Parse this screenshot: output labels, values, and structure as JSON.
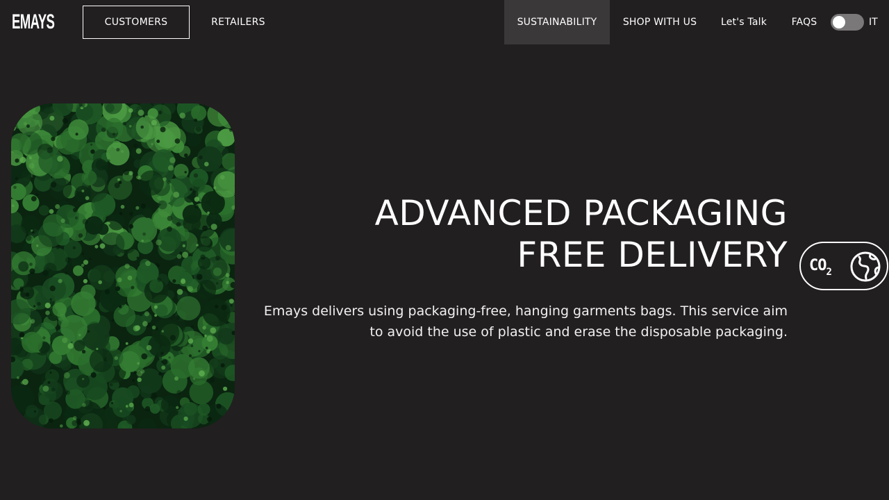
{
  "brand": {
    "logo_text": "EMAYS"
  },
  "nav": {
    "customers": "CUSTOMERS",
    "retailers": "RETAILERS",
    "sustainability": "SUSTAINABILITY",
    "shop": "SHOP WITH US",
    "talk": "Let's Talk",
    "faqs": "FAQS",
    "language": "IT",
    "language_toggle_on": false
  },
  "hero": {
    "title_line1": "ADVANCED PACKAGING",
    "title_line2": "FREE DELIVERY",
    "description": "Emays delivers using packaging-free, hanging garments bags. This service aim to avoid the use of plastic and erase the disposable packaging.",
    "image_icon": "forest-aerial-image"
  },
  "badge": {
    "co2_main": "CO",
    "co2_sub": "2",
    "icon": "globe-icon"
  },
  "colors": {
    "background": "#221f20",
    "active_nav_bg": "#3b3839",
    "text": "#ffffff",
    "toggle_track": "#7a7879"
  }
}
